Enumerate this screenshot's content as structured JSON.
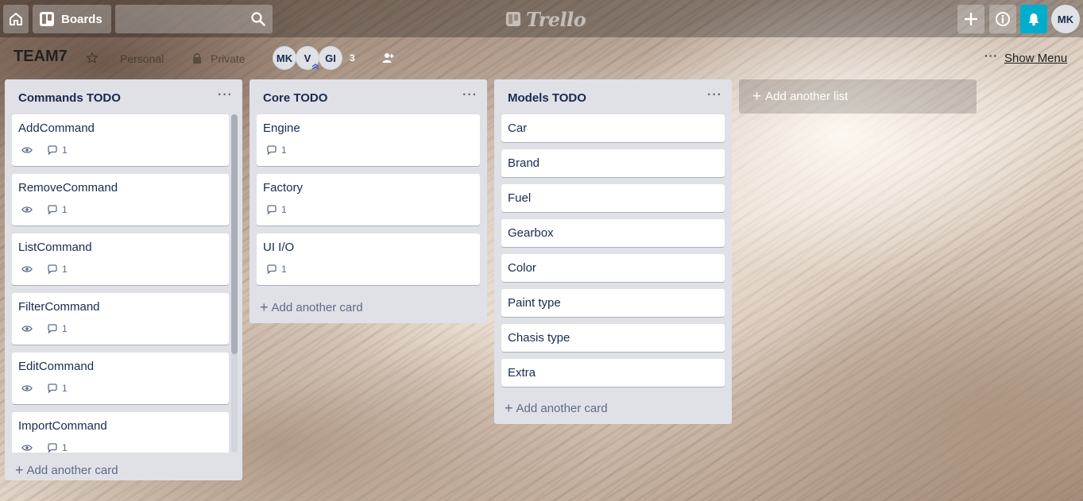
{
  "header": {
    "boards_label": "Boards",
    "search_placeholder": "",
    "logo_text": "Trello",
    "user_initials": "MK",
    "bell_color": "#00aecc"
  },
  "board": {
    "title": "TEAM7",
    "team": "Personal",
    "privacy": "Private",
    "members": [
      "MK",
      "V",
      "GI"
    ],
    "member_count": "3",
    "menu_dots": "···",
    "show_menu": "Show Menu"
  },
  "lists": [
    {
      "title": "Commands TODO",
      "menu": "···",
      "add_card": "Add another card",
      "cards": [
        {
          "title": "AddCommand",
          "comments": "1"
        },
        {
          "title": "RemoveCommand",
          "comments": "1"
        },
        {
          "title": "ListCommand",
          "comments": "1"
        },
        {
          "title": "FilterCommand",
          "comments": "1"
        },
        {
          "title": "EditCommand",
          "comments": "1"
        },
        {
          "title": "ImportCommand",
          "comments": "1"
        }
      ]
    },
    {
      "title": "Core TODO",
      "menu": "···",
      "add_card": "Add another card",
      "cards": [
        {
          "title": "Engine",
          "comments": "1"
        },
        {
          "title": "Factory",
          "comments": "1"
        },
        {
          "title": "UI I/O",
          "comments": "1"
        }
      ]
    },
    {
      "title": "Models TODO",
      "menu": "···",
      "add_card": "Add another card",
      "cards": [
        {
          "title": "Car"
        },
        {
          "title": "Brand"
        },
        {
          "title": "Fuel"
        },
        {
          "title": "Gearbox"
        },
        {
          "title": "Color"
        },
        {
          "title": "Paint type"
        },
        {
          "title": "Chasis type"
        },
        {
          "title": "Extra"
        }
      ]
    }
  ],
  "add_list_label": "Add another list",
  "plus_sign": "+"
}
